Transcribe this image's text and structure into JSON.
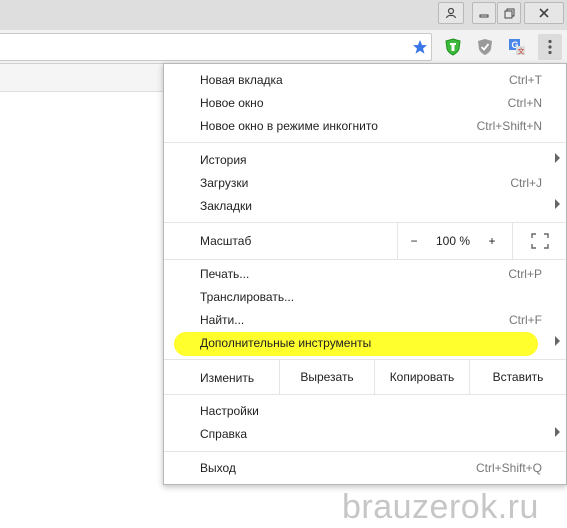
{
  "menu": {
    "items": [
      {
        "label": "Новая вкладка",
        "shortcut": "Ctrl+T"
      },
      {
        "label": "Новое окно",
        "shortcut": "Ctrl+N"
      },
      {
        "label": "Новое окно в режиме инкогнито",
        "shortcut": "Ctrl+Shift+N"
      },
      {
        "label": "История",
        "shortcut": ""
      },
      {
        "label": "Загрузки",
        "shortcut": "Ctrl+J"
      },
      {
        "label": "Закладки",
        "shortcut": ""
      },
      {
        "label": "Печать...",
        "shortcut": "Ctrl+P"
      },
      {
        "label": "Транслировать...",
        "shortcut": ""
      },
      {
        "label": "Найти...",
        "shortcut": "Ctrl+F"
      },
      {
        "label": "Дополнительные инструменты",
        "shortcut": ""
      },
      {
        "label": "Настройки",
        "shortcut": ""
      },
      {
        "label": "Справка",
        "shortcut": ""
      },
      {
        "label": "Выход",
        "shortcut": "Ctrl+Shift+Q"
      }
    ],
    "zoom": {
      "label": "Масштаб",
      "minus": "−",
      "value": "100 %",
      "plus": "+"
    },
    "edit": {
      "label": "Изменить",
      "cut": "Вырезать",
      "copy": "Копировать",
      "paste": "Вставить"
    }
  },
  "highlight_color": "#ffff2e",
  "watermark": "brauzerok.ru",
  "icons": [
    "user-icon",
    "minimize-icon",
    "restore-icon",
    "close-icon",
    "bookmark-star-icon",
    "shield-extension-icon",
    "gray-shield-extension-icon",
    "translate-extension-icon",
    "menu-dots-icon",
    "fullscreen-icon",
    "submenu-arrow-icon"
  ]
}
